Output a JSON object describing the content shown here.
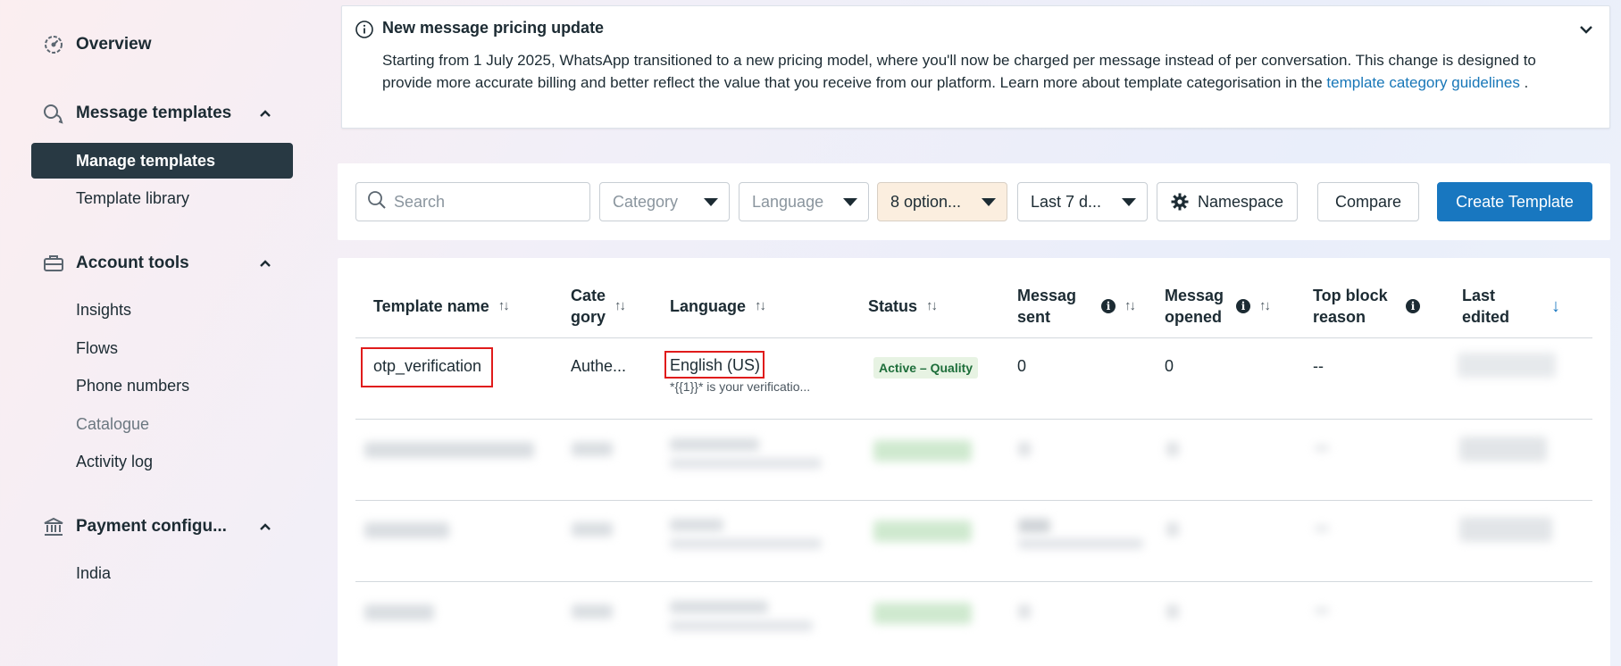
{
  "sidebar": {
    "overview": "Overview",
    "message_templates": "Message templates",
    "manage_templates": "Manage templates",
    "template_library": "Template library",
    "account_tools": "Account tools",
    "insights": "Insights",
    "flows": "Flows",
    "phone_numbers": "Phone numbers",
    "catalogue": "Catalogue",
    "activity_log": "Activity log",
    "payment_config": "Payment configu...",
    "india": "India"
  },
  "banner": {
    "title": "New message pricing update",
    "body": "Starting from 1 July 2025, WhatsApp transitioned to a new pricing model, where you'll now be charged per message instead of per conversation. This change is designed to provide more accurate billing and better reflect the value that you receive from our platform. Learn more about template categorisation in the ",
    "link": "template category guidelines",
    "end": " ."
  },
  "toolbar": {
    "search_placeholder": "Search",
    "category": "Category",
    "language": "Language",
    "options": "8 option...",
    "date": "Last 7 d...",
    "namespace": "Namespace",
    "compare": "Compare",
    "create": "Create Template"
  },
  "table": {
    "headers": {
      "template_name": "Template name",
      "category_1": "Cate",
      "category_2": "gory",
      "language": "Language",
      "status": "Status",
      "msg_sent_1": "Messag",
      "msg_sent_2": "sent",
      "msg_opened_1": "Messag",
      "msg_opened_2": "opened",
      "top_block_1": "Top block",
      "top_block_2": "reason",
      "last_edited_1": "Last",
      "last_edited_2": "edited"
    },
    "row": {
      "name": "otp_verification",
      "category": "Authe...",
      "language": "English (US)",
      "preview": "*{{1}}* is your verificatio...",
      "status": "Active – Quality",
      "sent": "0",
      "opened": "0",
      "block": "--"
    }
  },
  "colors": {
    "primary": "#1877c0",
    "active_nav": "#283943",
    "highlight": "#e01b1b"
  }
}
